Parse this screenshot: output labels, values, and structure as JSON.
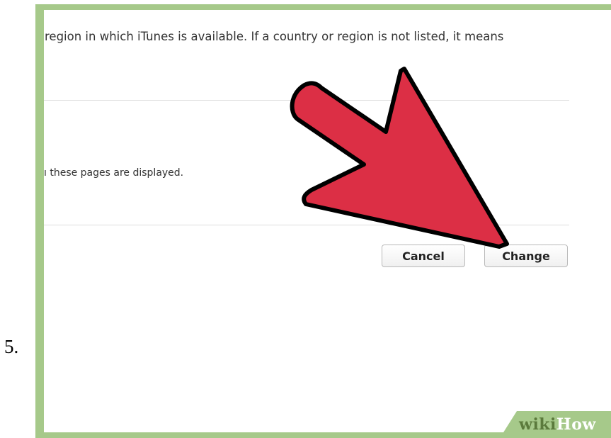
{
  "step": {
    "number": "5."
  },
  "dialog": {
    "availability_text": "region in which iTunes is available. If a country or region is not listed, it means",
    "pages_text": "ı these pages are displayed.",
    "cancel_label": "Cancel",
    "change_label": "Change"
  },
  "annotation": {
    "type": "arrow-pointer-icon",
    "color": "#dc2f45",
    "points_to": "Change"
  },
  "branding": {
    "logo_wiki": "wiki",
    "logo_how": "How"
  },
  "colors": {
    "frame": "#a6c98a",
    "arrow": "#dc2f45",
    "logo_dark": "#5b7a3c"
  }
}
